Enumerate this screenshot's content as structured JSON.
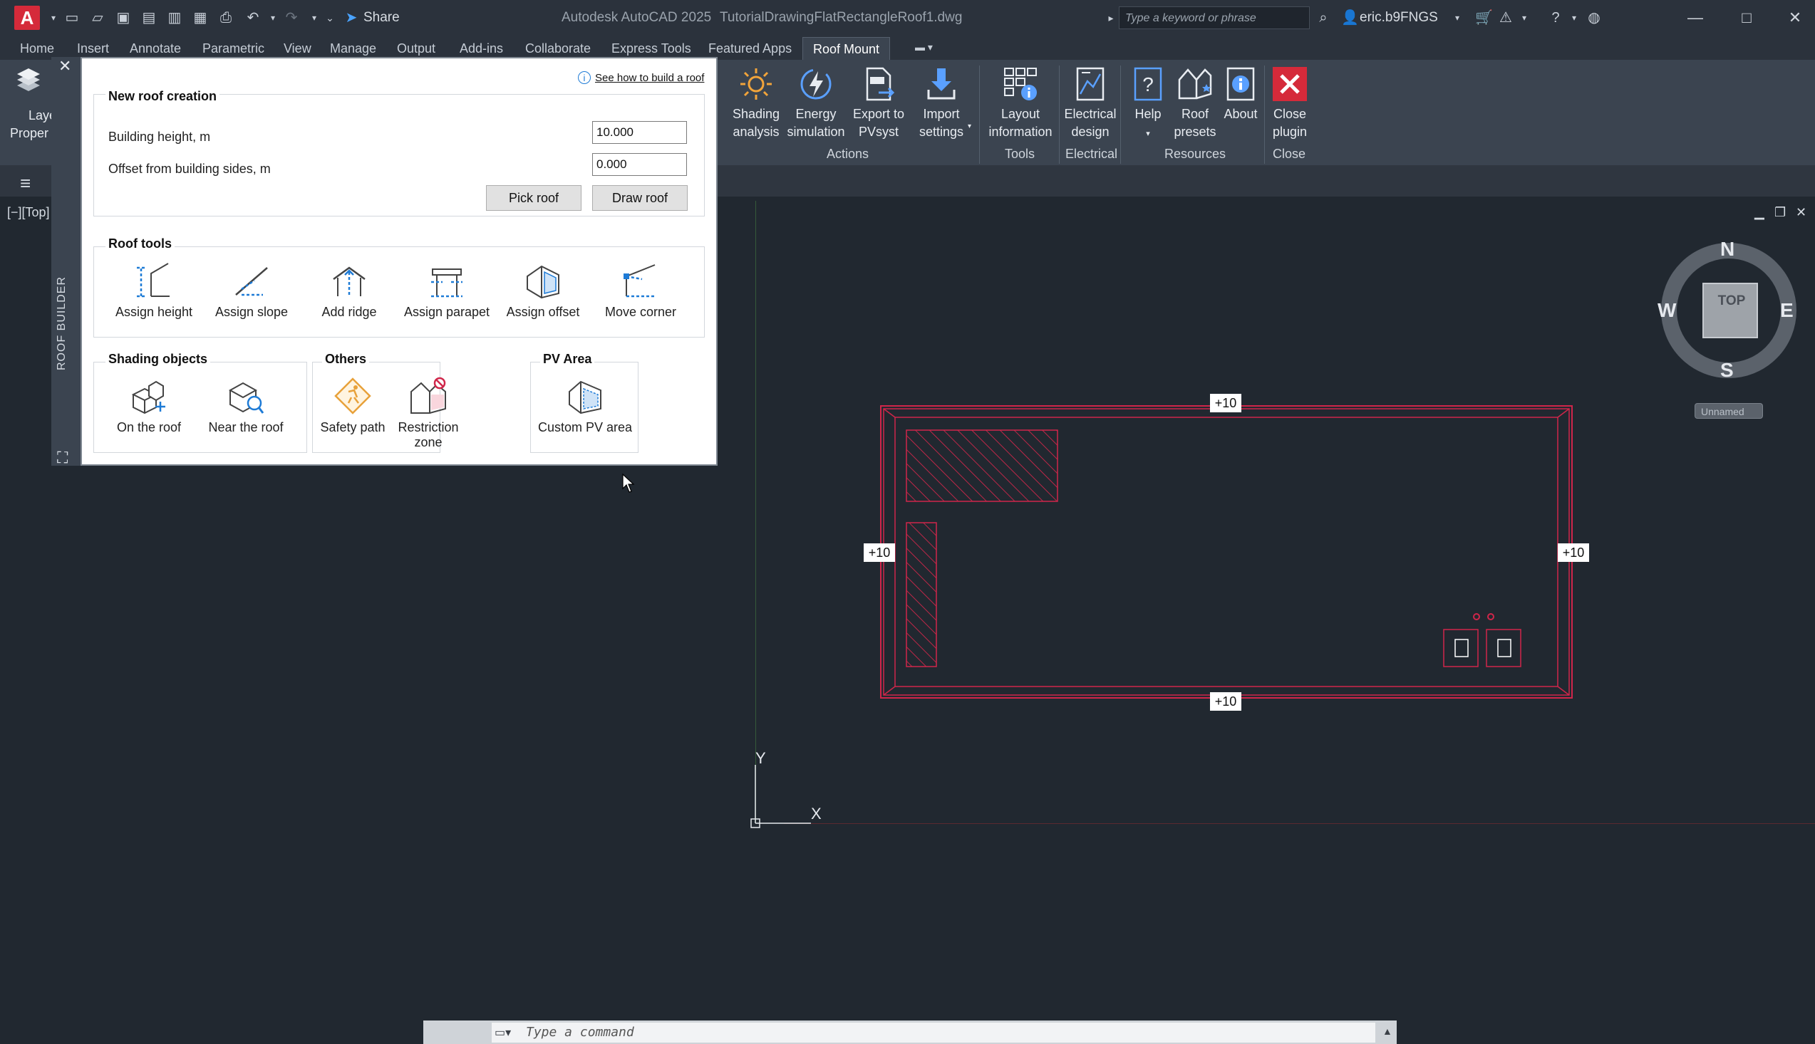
{
  "titlebar": {
    "app_letter": "A",
    "share_label": "Share",
    "app_name": "Autodesk AutoCAD 2025",
    "doc_name": "TutorialDrawingFlatRectangleRoof1.dwg",
    "search_placeholder": "Type a keyword or phrase",
    "user": "eric.b9FNGS"
  },
  "tabs": [
    "Home",
    "Insert",
    "Annotate",
    "Parametric",
    "View",
    "Manage",
    "Output",
    "Add-ins",
    "Collaborate",
    "Express Tools",
    "Featured Apps",
    "Roof Mount"
  ],
  "active_tab": "Roof Mount",
  "ribbon": {
    "left_partial": {
      "line1": "Laye",
      "line2": "Proper"
    },
    "buttons": [
      {
        "id": "shading",
        "line1": "Shading",
        "line2": "analysis",
        "icon": "sun-icon"
      },
      {
        "id": "energy",
        "line1": "Energy",
        "line2": "simulation",
        "icon": "energy-icon"
      },
      {
        "id": "export",
        "line1": "Export to",
        "line2": "PVsyst",
        "icon": "export-pvsyst-icon"
      },
      {
        "id": "import",
        "line1": "Import",
        "line2": "settings",
        "icon": "import-icon"
      },
      {
        "id": "layout",
        "line1": "Layout",
        "line2": "information",
        "icon": "layout-info-icon"
      },
      {
        "id": "electrical",
        "line1": "Electrical",
        "line2": "design",
        "icon": "electrical-icon"
      },
      {
        "id": "help",
        "line1": "Help",
        "line2": "",
        "icon": "help-icon"
      },
      {
        "id": "presets",
        "line1": "Roof",
        "line2": "presets",
        "icon": "roof-presets-icon"
      },
      {
        "id": "about",
        "line1": "About",
        "line2": "",
        "icon": "about-icon"
      },
      {
        "id": "close",
        "line1": "Close",
        "line2": "plugin",
        "icon": "close-plugin-icon"
      }
    ],
    "groups": [
      "Actions",
      "Tools",
      "Electrical",
      "Resources",
      "Close"
    ]
  },
  "viewport": {
    "label": "[−][Top]",
    "compass": {
      "n": "N",
      "s": "S",
      "e": "E",
      "w": "W",
      "cube": "TOP",
      "ucs": "Unnamed"
    },
    "axis_y": "Y",
    "axis_x": "X",
    "height_tags": [
      "+10",
      "+10",
      "+10",
      "+10"
    ]
  },
  "palette": {
    "side_label": "ROOF BUILDER",
    "help_link": "See how to build a roof",
    "new_roof": {
      "title": "New roof creation",
      "height_label": "Building height, m",
      "height_value": "10.000",
      "offset_label": "Offset from building sides, m",
      "offset_value": "0.000",
      "pick_btn": "Pick roof",
      "draw_btn": "Draw roof"
    },
    "roof_tools": {
      "title": "Roof tools",
      "items": [
        "Assign height",
        "Assign slope",
        "Add ridge",
        "Assign parapet",
        "Assign offset",
        "Move corner"
      ]
    },
    "shading": {
      "title": "Shading objects",
      "items": [
        "On the roof",
        "Near the roof"
      ]
    },
    "others": {
      "title": "Others",
      "items": [
        "Safety path",
        "Restriction zone"
      ]
    },
    "pv_area": {
      "title": "PV Area",
      "items": [
        "Custom PV area"
      ]
    }
  },
  "command": {
    "placeholder": "Type a command"
  },
  "colors": {
    "accent": "#1e7bd6",
    "roof_red": "#d0264a",
    "background": "#212830"
  }
}
